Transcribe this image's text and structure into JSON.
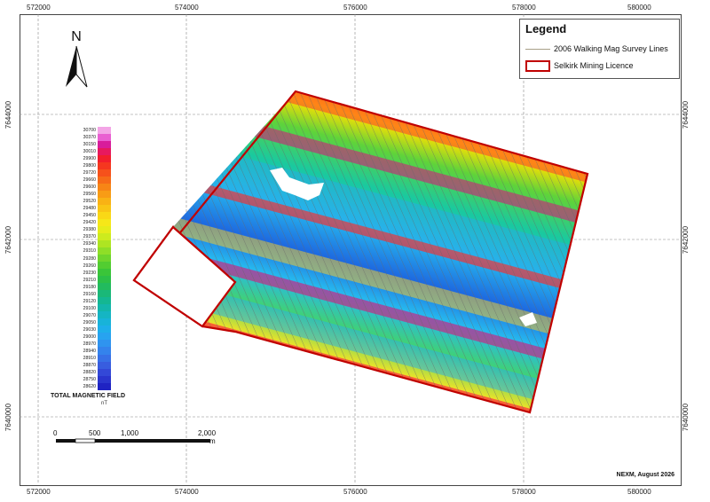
{
  "map": {
    "x_ticks": [
      "572000",
      "574000",
      "576000",
      "578000",
      "580000"
    ],
    "y_ticks": [
      "7644000",
      "7642000",
      "7640000"
    ],
    "colors": {
      "licence_boundary": "#c00000",
      "survey_line": "#a89f88"
    }
  },
  "legend": {
    "title": "Legend",
    "items": [
      {
        "label": "2006 Walking Mag Survey Lines",
        "symbol": "line"
      },
      {
        "label": "Selkirk Mining Licence",
        "symbol": "polygon"
      }
    ]
  },
  "colorbar": {
    "values": [
      "30700",
      "30370",
      "30150",
      "30010",
      "29900",
      "29800",
      "29720",
      "29660",
      "29600",
      "29560",
      "29520",
      "29480",
      "29450",
      "29420",
      "29380",
      "29370",
      "29340",
      "29310",
      "29280",
      "29260",
      "29230",
      "29210",
      "29180",
      "29160",
      "29120",
      "29100",
      "29070",
      "29050",
      "29030",
      "29000",
      "28970",
      "28940",
      "28910",
      "28870",
      "28820",
      "28750",
      "28620"
    ],
    "title": "TOTAL MAGNETIC FIELD",
    "unit": "nT"
  },
  "north_arrow": {
    "label": "N"
  },
  "scale_bar": {
    "labels": [
      "0",
      "500",
      "1,000",
      "2,000"
    ],
    "unit": "m"
  },
  "credit": "NEXM, August 2026"
}
